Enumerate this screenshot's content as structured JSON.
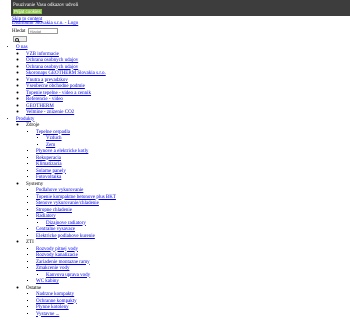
{
  "cookie_bar": {
    "notice": "Pouzivanie Vasu odkazov udvoli",
    "accept": "Prijat cookies"
  },
  "skip_link": "Skip to content",
  "logo_link": "Distributor Slovakia s.r.o. - Logo",
  "search": {
    "label": "Hledat",
    "placeholder": "Hladat"
  },
  "menu": [
    {
      "label": "O nas",
      "children": [
        {
          "label": "VZB informacie"
        },
        {
          "label": "Ochrana osobnych udajov"
        },
        {
          "label": "Ochrana osobnych udajov"
        },
        {
          "label": "Skoronaps GEOTHERM Slovakia s.r.o."
        },
        {
          "label": "Vnutra a prevadzkov"
        },
        {
          "label": "Vseobecne obchodne podmie"
        },
        {
          "label": "Topenie tepelne - video a cennik"
        },
        {
          "label": "Referencie - video"
        },
        {
          "label": "GEOTHERM"
        },
        {
          "label": "Velmine - znizenie CO2"
        }
      ]
    },
    {
      "label": "Produkty",
      "children": [
        {
          "label": "Zdroje",
          "children": [
            {
              "label": "Tepelne cerpadla",
              "children": [
                {
                  "label": "Vzduch"
                },
                {
                  "label": "Zem"
                }
              ]
            },
            {
              "label": "Plynove a elektricke kotly"
            },
            {
              "label": "Rekuperacia"
            },
            {
              "label": "Klimatizacia"
            },
            {
              "label": "Solarne panely"
            },
            {
              "label": "Fotovoltaika"
            }
          ]
        },
        {
          "label": "Systemy",
          "children": [
            {
              "label": "Podlahove vykurovanie"
            },
            {
              "label": "Topenie kompaktne betonove plus BKT"
            },
            {
              "label": "Stenove vykurovanie/chladenie"
            },
            {
              "label": "Stropne chladenie"
            },
            {
              "label": "Radiatory",
              "children": [
                {
                  "label": "Dizajnove radiatory"
                }
              ]
            },
            {
              "label": "Centralne vysavace"
            },
            {
              "label": "Elektricke podlahove kurenie"
            }
          ]
        },
        {
          "label": "ZTI",
          "children": [
            {
              "label": "Rozvody pitnej vody"
            },
            {
              "label": "Rozvody kanalizacie"
            },
            {
              "label": "Zariadenie montazne ramy"
            },
            {
              "label": "Zmakcenie vody",
              "children": [
                {
                  "label": "Kanvova uprava vody"
                }
              ]
            },
            {
              "label": "WC kabiny"
            }
          ]
        },
        {
          "label": "Ostatne",
          "children": [
            {
              "label": "Nadrzne kompakty"
            },
            {
              "label": "Ochranne kompakty"
            },
            {
              "label": "Plynne kotoleny"
            },
            {
              "label": "Vystavne ..."
            }
          ]
        }
      ]
    }
  ]
}
